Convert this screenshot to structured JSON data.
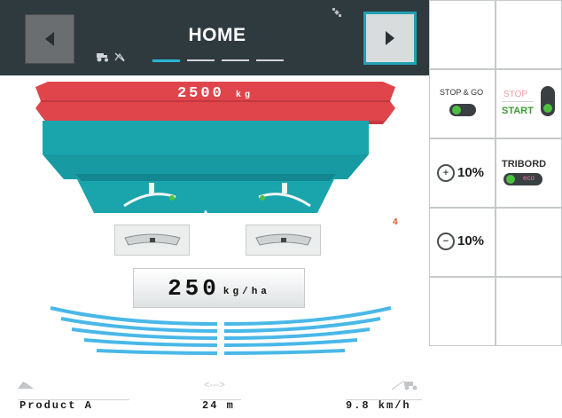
{
  "header": {
    "title": "HOME",
    "pages": 4,
    "active_page": 1
  },
  "icons": {
    "prev": "chevron-left-icon",
    "next": "chevron-right-icon",
    "tractor": "tractor-icon",
    "no_signal": "no-signal-icon",
    "gps": "satellite-icon"
  },
  "spreader": {
    "hopper_weight": "2500",
    "hopper_unit": "kg",
    "application_rate": "250",
    "rate_unit": "kg/ha",
    "alert_badge": "4"
  },
  "footer": {
    "product": "Product A",
    "working_width": "24 m",
    "speed": "9.8 km/h"
  },
  "right_panel": {
    "stop_go": "STOP & GO",
    "stop": "STOP",
    "start": "START",
    "increase_rate": "10%",
    "decrease_rate": "10%",
    "tribord": "TRIBORD",
    "eco": "eco"
  },
  "colors": {
    "header_bg": "#2f3a3f",
    "hopper_red": "#e0454c",
    "body_teal": "#1aa5ad",
    "spread_blue": "#49b8e8",
    "accent": "#21a1b4",
    "toggle_green": "#4ec03f"
  }
}
